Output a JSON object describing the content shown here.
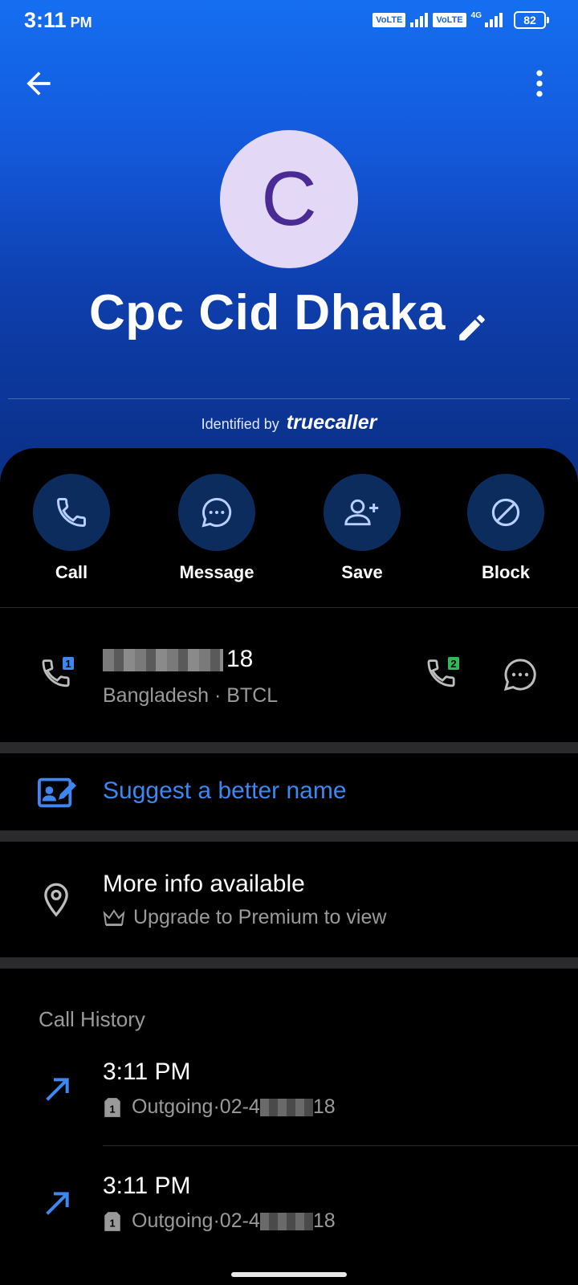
{
  "status_bar": {
    "time": "3:11",
    "ampm": "PM",
    "volte1": "VoLTE",
    "volte2": "VoLTE",
    "network": "4G",
    "battery": "82"
  },
  "contact": {
    "initial": "C",
    "name": "Cpc Cid Dhaka",
    "identified_prefix": "Identified by",
    "identified_brand": "truecaller"
  },
  "actions": [
    {
      "label": "Call",
      "icon": "phone-icon"
    },
    {
      "label": "Message",
      "icon": "chat-icon"
    },
    {
      "label": "Save",
      "icon": "add-person-icon"
    },
    {
      "label": "Block",
      "icon": "block-icon"
    }
  ],
  "number": {
    "visible_suffix": "18",
    "carrier_line": "Bangladesh · BTCL",
    "sim1_badge": "1",
    "sim2_badge": "2"
  },
  "suggest": {
    "label": "Suggest a better name"
  },
  "more_info": {
    "title": "More info available",
    "subtitle": "Upgrade to Premium to view"
  },
  "call_history": {
    "title": "Call History",
    "items": [
      {
        "time": "3:11 PM",
        "type": "Outgoing",
        "number_prefix": "02-4",
        "number_suffix": "18"
      },
      {
        "time": "3:11 PM",
        "type": "Outgoing",
        "number_prefix": "02-4",
        "number_suffix": "18"
      }
    ]
  },
  "colors": {
    "header_top": "#156ef0",
    "header_bottom": "#0a2f86",
    "accent_blue": "#3e86f0",
    "action_circle": "#0d2c5e",
    "avatar_bg": "#e3d8f6",
    "avatar_text": "#4a2b95",
    "sim2_green": "#2dbb5a"
  }
}
